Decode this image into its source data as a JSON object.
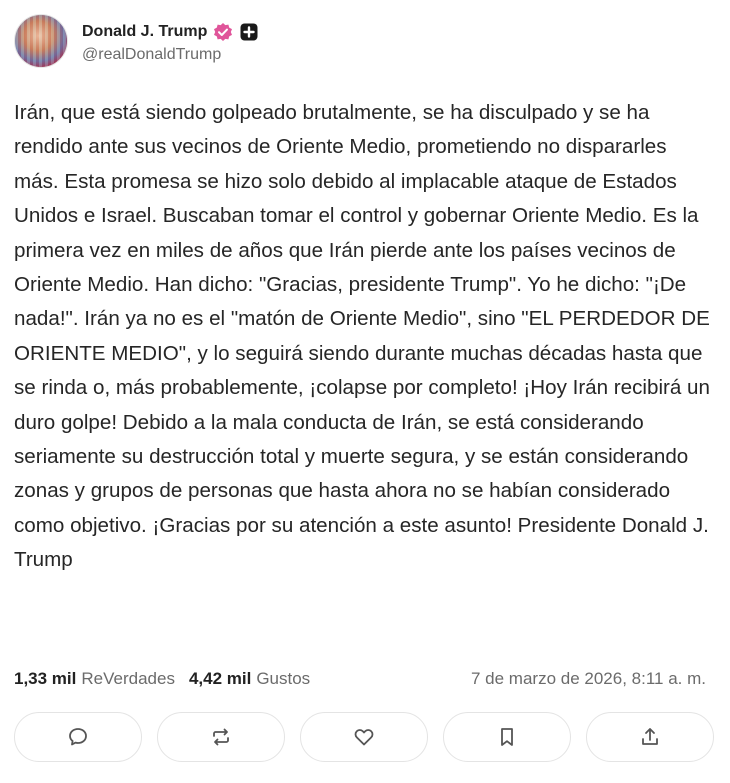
{
  "author": {
    "display_name": "Donald J. Trump",
    "handle": "@realDonaldTrump",
    "avatar_icon": "avatar-photo",
    "verified_icon": "verified-badge-icon",
    "verified_color": "#e0559a",
    "extra_badge_icon": "plus-badge-icon"
  },
  "post": {
    "text": "Irán, que está siendo golpeado brutalmente, se ha disculpado y se ha rendido ante sus vecinos de Oriente Medio, prometiendo no dispararles más. Esta promesa se hizo solo debido al implacable ataque de Estados Unidos e Israel. Buscaban tomar el control y gobernar Oriente Medio. Es la primera vez en miles de años que Irán pierde ante los países vecinos de Oriente Medio. Han dicho: \"Gracias, presidente Trump\". Yo he dicho: \"¡De nada!\". Irán ya no es el \"matón de Oriente Medio\", sino \"EL PERDEDOR DE ORIENTE MEDIO\", y lo seguirá siendo durante muchas décadas hasta que se rinda o, más probablemente, ¡colapse por completo! ¡Hoy Irán recibirá un duro golpe! Debido a la mala conducta de Irán, se está considerando seriamente su destrucción total y muerte segura, y se están considerando zonas y grupos de personas que hasta ahora no se habían considerado como objetivo. ¡Gracias por su atención a este asunto! Presidente Donald J. Trump"
  },
  "stats": {
    "retruths_count": "1,33 mil",
    "retruths_label": "ReVerdades",
    "likes_count": "4,42 mil",
    "likes_label": "Gustos",
    "timestamp": "7 de marzo de 2026, 8:11 a. m."
  },
  "actions": [
    {
      "name": "reply",
      "icon": "comment-icon"
    },
    {
      "name": "retruth",
      "icon": "repost-icon"
    },
    {
      "name": "like",
      "icon": "heart-icon"
    },
    {
      "name": "bookmark",
      "icon": "bookmark-icon"
    },
    {
      "name": "share",
      "icon": "share-icon"
    }
  ]
}
